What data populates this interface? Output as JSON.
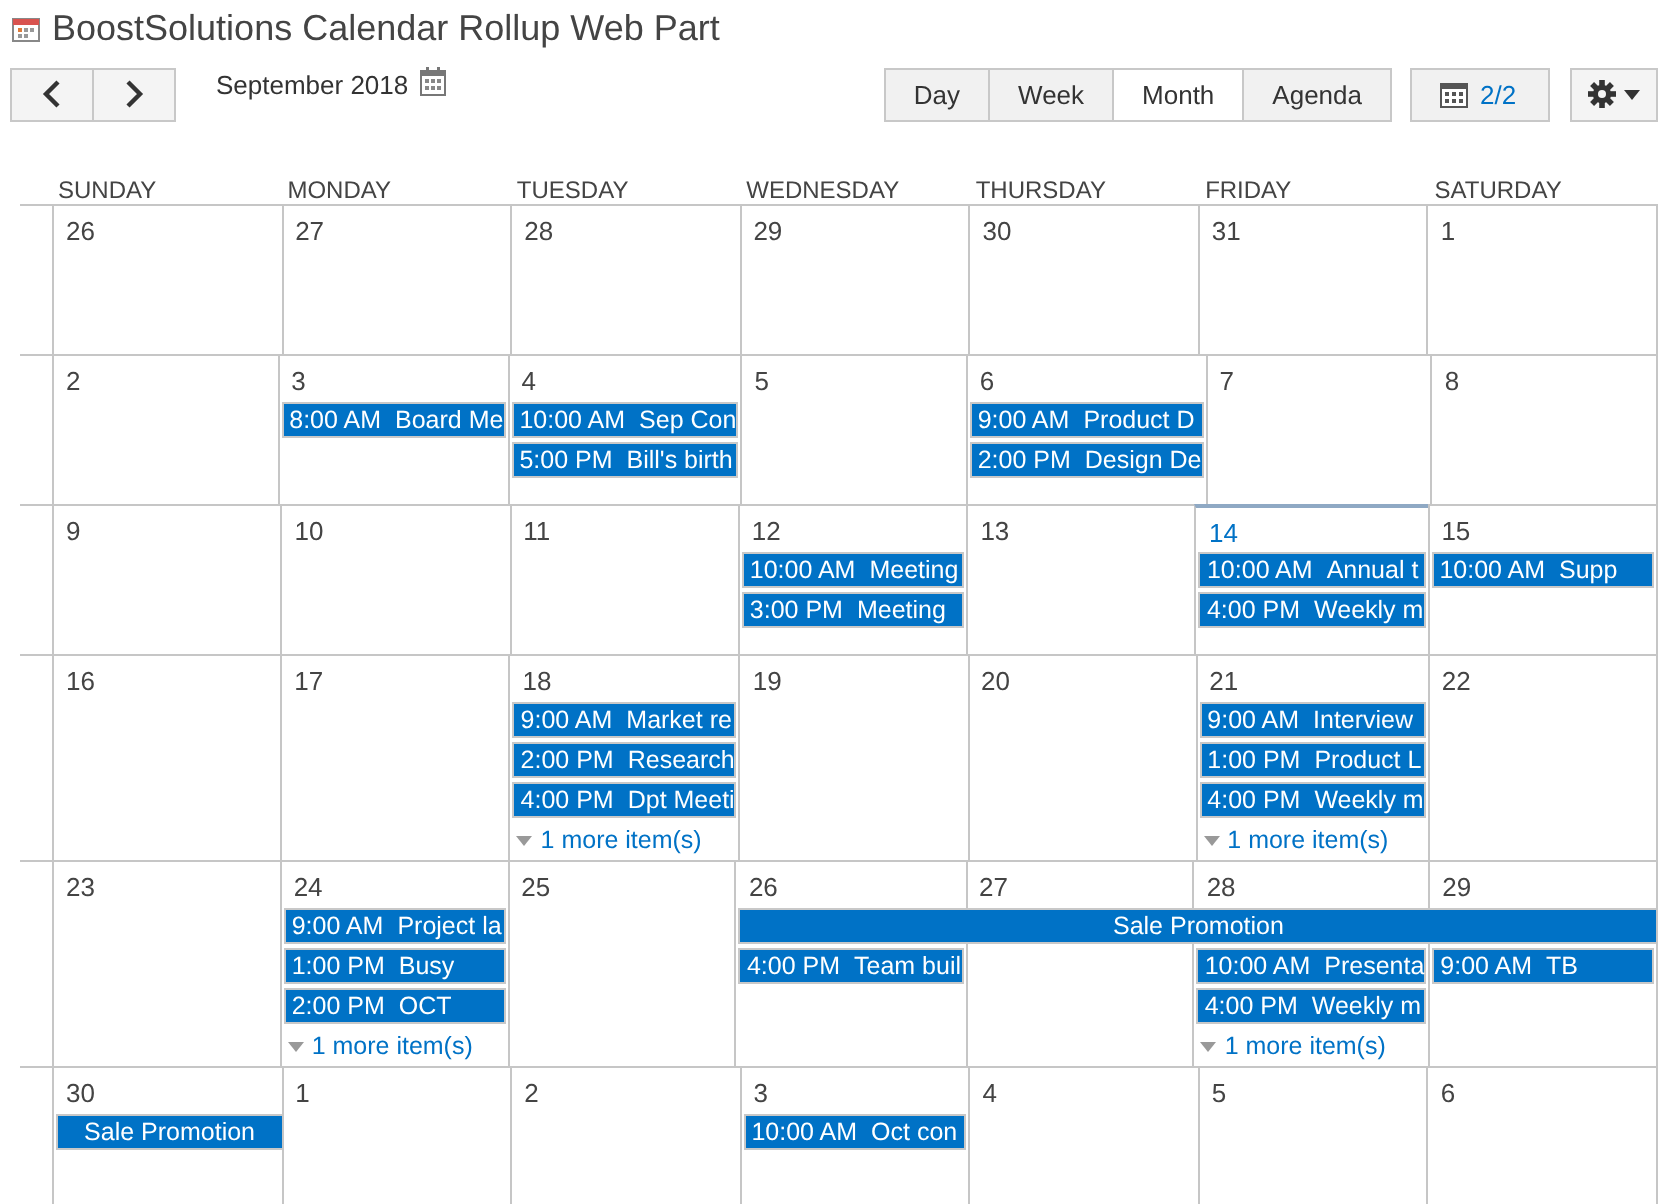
{
  "title": "BoostSolutions Calendar Rollup Web Part",
  "toolbar": {
    "month_label": "September 2018",
    "views": [
      {
        "label": "Day",
        "selected": false
      },
      {
        "label": "Week",
        "selected": false
      },
      {
        "label": "Month",
        "selected": true
      },
      {
        "label": "Agenda",
        "selected": false
      }
    ],
    "pager": "2/2"
  },
  "weekdays": [
    "SUNDAY",
    "MONDAY",
    "TUESDAY",
    "WEDNESDAY",
    "THURSDAY",
    "FRIDAY",
    "SATURDAY"
  ],
  "weeks": [
    {
      "days": [
        {
          "number": "26",
          "today": false,
          "in_banner": false
        },
        {
          "number": "27",
          "today": false,
          "in_banner": false
        },
        {
          "number": "28",
          "today": false,
          "in_banner": false
        },
        {
          "number": "29",
          "today": false,
          "in_banner": false
        },
        {
          "number": "30",
          "today": false,
          "in_banner": false
        },
        {
          "number": "31",
          "today": false,
          "in_banner": false
        },
        {
          "number": "1",
          "today": false,
          "in_banner": false
        }
      ]
    },
    {
      "days": [
        {
          "number": "2",
          "today": false,
          "in_banner": false
        },
        {
          "number": "3",
          "today": false,
          "in_banner": false,
          "events": [
            {
              "time": "8:00 AM",
              "title": "Board Me"
            }
          ]
        },
        {
          "number": "4",
          "today": false,
          "in_banner": false,
          "events": [
            {
              "time": "10:00 AM",
              "title": "Sep Con"
            },
            {
              "time": "5:00 PM",
              "title": "Bill's birth"
            }
          ]
        },
        {
          "number": "5",
          "today": false,
          "in_banner": false
        },
        {
          "number": "6",
          "today": false,
          "in_banner": false,
          "events": [
            {
              "time": "9:00 AM",
              "title": "Product D"
            },
            {
              "time": "2:00 PM",
              "title": "Design De"
            }
          ]
        },
        {
          "number": "7",
          "today": false,
          "in_banner": false
        },
        {
          "number": "8",
          "today": false,
          "in_banner": false
        }
      ]
    },
    {
      "days": [
        {
          "number": "9",
          "today": false,
          "in_banner": false
        },
        {
          "number": "10",
          "today": false,
          "in_banner": false
        },
        {
          "number": "11",
          "today": false,
          "in_banner": false
        },
        {
          "number": "12",
          "today": false,
          "in_banner": false,
          "events": [
            {
              "time": "10:00 AM",
              "title": "Meeting"
            },
            {
              "time": "3:00 PM",
              "title": "Meeting"
            }
          ]
        },
        {
          "number": "13",
          "today": false,
          "in_banner": false
        },
        {
          "number": "14",
          "today": true,
          "in_banner": false,
          "events": [
            {
              "time": "10:00 AM",
              "title": "Annual t"
            },
            {
              "time": "4:00 PM",
              "title": "Weekly m"
            }
          ]
        },
        {
          "number": "15",
          "today": false,
          "in_banner": false,
          "events": [
            {
              "time": "10:00 AM",
              "title": "Supp"
            }
          ]
        }
      ]
    },
    {
      "days": [
        {
          "number": "16",
          "today": false,
          "in_banner": false
        },
        {
          "number": "17",
          "today": false,
          "in_banner": false
        },
        {
          "number": "18",
          "today": false,
          "in_banner": false,
          "events": [
            {
              "time": "9:00 AM",
              "title": "Market re"
            },
            {
              "time": "2:00 PM",
              "title": "Research"
            },
            {
              "time": "4:00 PM",
              "title": "Dpt Meeti"
            }
          ],
          "more": "1 more item(s)"
        },
        {
          "number": "19",
          "today": false,
          "in_banner": false
        },
        {
          "number": "20",
          "today": false,
          "in_banner": false
        },
        {
          "number": "21",
          "today": false,
          "in_banner": false,
          "events": [
            {
              "time": "9:00 AM",
              "title": "Interview"
            },
            {
              "time": "1:00 PM",
              "title": "Product L"
            },
            {
              "time": "4:00 PM",
              "title": "Weekly m"
            }
          ],
          "more": "1 more item(s)"
        },
        {
          "number": "22",
          "today": false,
          "in_banner": false
        }
      ]
    },
    {
      "banner": {
        "title": "Sale Promotion"
      },
      "days": [
        {
          "number": "23",
          "today": false,
          "in_banner": false
        },
        {
          "number": "24",
          "today": false,
          "in_banner": false,
          "events": [
            {
              "time": "9:00 AM",
              "title": "Project la"
            },
            {
              "time": "1:00 PM",
              "title": "Busy"
            },
            {
              "time": "2:00 PM",
              "title": "OCT"
            }
          ],
          "more": "1 more item(s)"
        },
        {
          "number": "25",
          "today": false,
          "in_banner": false
        },
        {
          "number": "26",
          "today": false,
          "in_banner": true,
          "events": [
            {
              "time": "4:00 PM",
              "title": "Team buil"
            }
          ]
        },
        {
          "number": "27",
          "today": false,
          "in_banner": true
        },
        {
          "number": "28",
          "today": false,
          "in_banner": true,
          "events": [
            {
              "time": "10:00 AM",
              "title": "Presenta"
            },
            {
              "time": "4:00 PM",
              "title": "Weekly m"
            }
          ],
          "more": "1 more item(s)"
        },
        {
          "number": "29",
          "today": false,
          "in_banner": true,
          "events": [
            {
              "time": "9:00 AM",
              "title": "TB"
            }
          ]
        }
      ]
    },
    {
      "banner": {
        "title": "Sale Promotion"
      },
      "days": [
        {
          "number": "30",
          "today": false,
          "in_banner": true
        },
        {
          "number": "1",
          "today": false,
          "in_banner": false
        },
        {
          "number": "2",
          "today": false,
          "in_banner": false
        },
        {
          "number": "3",
          "today": false,
          "in_banner": false,
          "events": [
            {
              "time": "10:00 AM",
              "title": "Oct con"
            }
          ]
        },
        {
          "number": "4",
          "today": false,
          "in_banner": false
        },
        {
          "number": "5",
          "today": false,
          "in_banner": false
        },
        {
          "number": "6",
          "today": false,
          "in_banner": false
        }
      ]
    }
  ]
}
